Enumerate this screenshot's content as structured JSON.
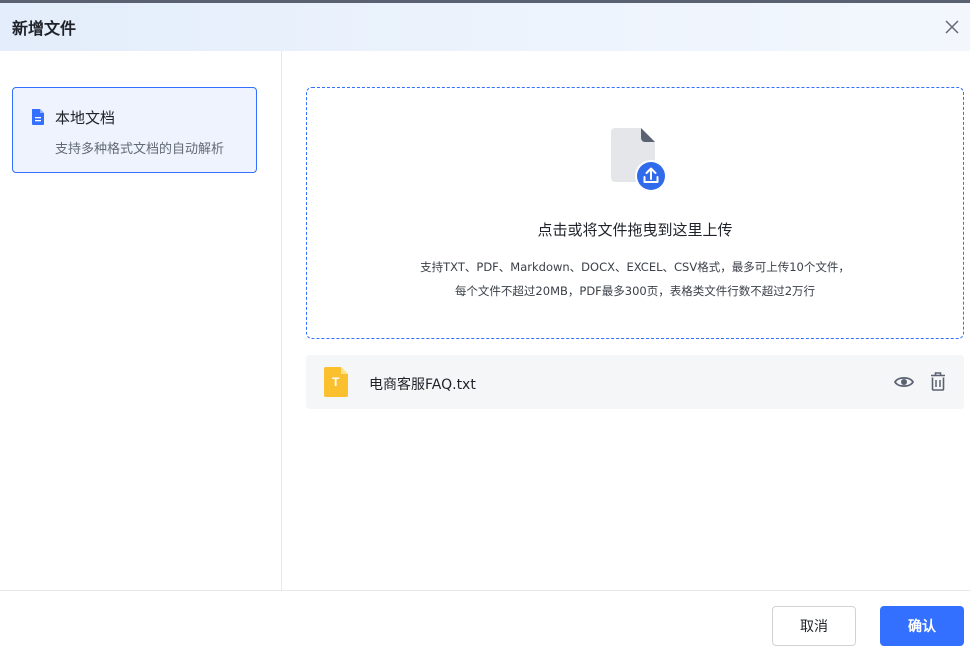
{
  "dialog": {
    "title": "新增文件",
    "close_icon": "close-icon"
  },
  "sidebar": {
    "items": [
      {
        "label": "本地文档",
        "description": "支持多种格式文档的自动解析",
        "icon": "document-icon",
        "selected": true
      }
    ]
  },
  "upload": {
    "title": "点击或将文件拖曳到这里上传",
    "hint_line1": "支持TXT、PDF、Markdown、DOCX、EXCEL、CSV格式，最多可上传10个文件，",
    "hint_line2": "每个文件不超过20MB，PDF最多300页，表格类文件行数不超过2万行",
    "icon": "upload-file-icon"
  },
  "files": [
    {
      "name": "电商客服FAQ.txt",
      "type_letter": "T",
      "icon": "txt-file-icon"
    }
  ],
  "footer": {
    "cancel_label": "取消",
    "confirm_label": "确认"
  },
  "colors": {
    "accent": "#3370ff",
    "file_icon": "#fbc02d",
    "header_bg": "#e3edfb"
  }
}
